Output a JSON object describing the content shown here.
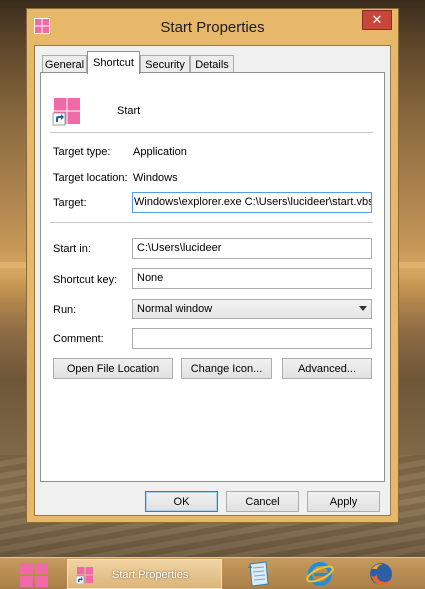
{
  "window": {
    "title": "Start Properties",
    "close_glyph": "✕"
  },
  "tabs": [
    {
      "label": "General"
    },
    {
      "label": "Shortcut"
    },
    {
      "label": "Security"
    },
    {
      "label": "Details"
    }
  ],
  "active_tab": "Shortcut",
  "shortcut": {
    "name": "Start",
    "target_type_label": "Target type:",
    "target_type_value": "Application",
    "target_location_label": "Target location:",
    "target_location_value": "Windows",
    "target_label": "Target:",
    "target_value": "Windows\\explorer.exe C:\\Users\\lucideer\\start.vbs",
    "start_in_label": "Start in:",
    "start_in_value": "C:\\Users\\lucideer",
    "shortcut_key_label": "Shortcut key:",
    "shortcut_key_value": "None",
    "run_label": "Run:",
    "run_value": "Normal window",
    "comment_label": "Comment:",
    "comment_value": "",
    "open_file_location_label": "Open File Location",
    "change_icon_label": "Change Icon...",
    "advanced_label": "Advanced..."
  },
  "dialog_buttons": {
    "ok": "OK",
    "cancel": "Cancel",
    "apply": "Apply"
  },
  "taskbar": {
    "active_item_label": "Start Properties",
    "icons": [
      "windows-start-icon",
      "notepad-icon",
      "internet-explorer-icon",
      "firefox-icon"
    ]
  },
  "colors": {
    "accent_pink": "#f06aa8",
    "window_frame": "#e8b86a",
    "close_red": "#c7463a",
    "focus_blue": "#569de5"
  }
}
